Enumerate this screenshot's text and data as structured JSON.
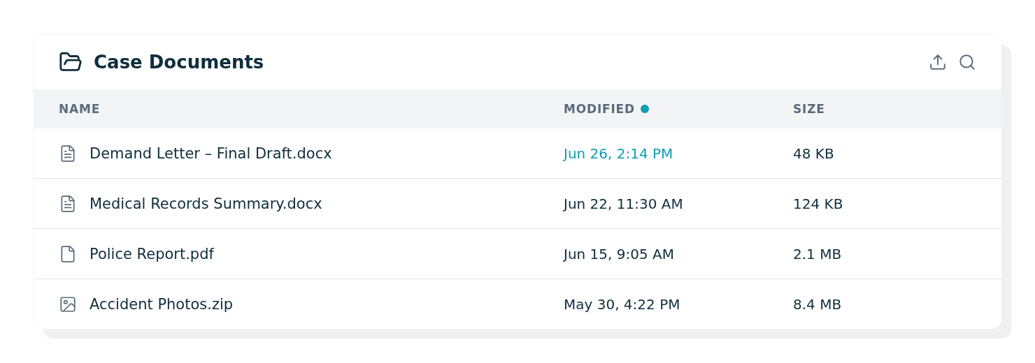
{
  "panel": {
    "title": "Case Documents"
  },
  "table": {
    "columns": [
      {
        "label": "NAME",
        "sorted": false
      },
      {
        "label": "MODIFIED",
        "sorted": true
      },
      {
        "label": "SIZE",
        "sorted": false
      }
    ],
    "rows": [
      {
        "kind": "document",
        "name": "Demand Letter – Final Draft.docx",
        "modified": "Jun 26, 2:14 PM",
        "recent": true,
        "size": "48 KB"
      },
      {
        "kind": "document",
        "name": "Medical Records Summary.docx",
        "modified": "Jun 22, 11:30 AM",
        "recent": false,
        "size": "124 KB"
      },
      {
        "kind": "file",
        "name": "Police Report.pdf",
        "modified": "Jun 15, 9:05 AM",
        "recent": false,
        "size": "2.1 MB"
      },
      {
        "kind": "image",
        "name": "Accident Photos.zip",
        "modified": "May 30, 4:22 PM",
        "recent": false,
        "size": "8.4 MB"
      }
    ]
  }
}
